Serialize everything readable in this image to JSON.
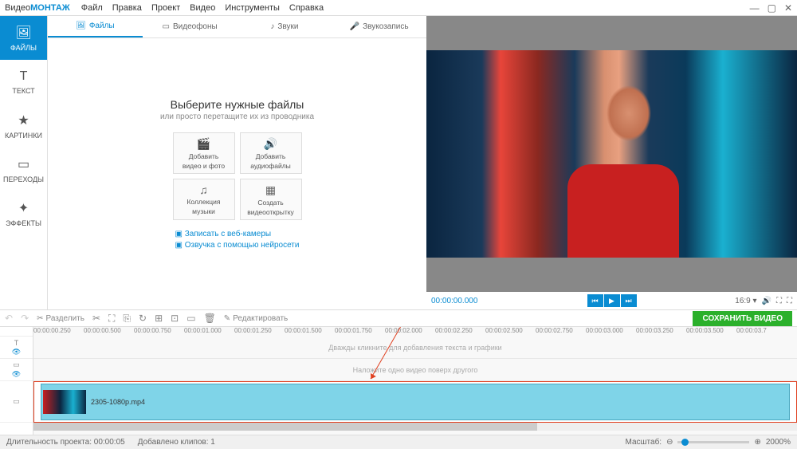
{
  "app": {
    "title_prefix": "Видео",
    "title_accent": "МОНТАЖ"
  },
  "menu": [
    "Файл",
    "Правка",
    "Проект",
    "Видео",
    "Инструменты",
    "Справка"
  ],
  "sidebar": [
    {
      "label": "ФАЙЛЫ",
      "icon": "🖼"
    },
    {
      "label": "ТЕКСТ",
      "icon": "T"
    },
    {
      "label": "КАРТИНКИ",
      "icon": "★"
    },
    {
      "label": "ПЕРЕХОДЫ",
      "icon": "▭"
    },
    {
      "label": "ЭФФЕКТЫ",
      "icon": "✦"
    }
  ],
  "center_tabs": [
    {
      "label": "Файлы",
      "icon": "🖼"
    },
    {
      "label": "Видеофоны",
      "icon": "▭"
    },
    {
      "label": "Звуки",
      "icon": "♪"
    },
    {
      "label": "Звукозапись",
      "icon": "🎤"
    }
  ],
  "drop": {
    "heading": "Выберите нужные файлы",
    "subheading": "или просто перетащите их из проводника",
    "buttons": [
      {
        "icon": "🎬",
        "line1": "Добавить",
        "line2": "видео и фото"
      },
      {
        "icon": "🔊",
        "line1": "Добавить",
        "line2": "аудиофайлы"
      },
      {
        "icon": "♫",
        "line1": "Коллекция",
        "line2": "музыки"
      },
      {
        "icon": "▦",
        "line1": "Создать",
        "line2": "видеооткрытку"
      }
    ],
    "link1": "Записать с веб-камеры",
    "link2": "Озвучка с помощью нейросети"
  },
  "preview": {
    "time": "00:00:00.000",
    "aspect": "16:9 ▾"
  },
  "toolbar": {
    "split": "Разделить",
    "edit": "Редактировать",
    "save": "СОХРАНИТЬ ВИДЕО"
  },
  "ruler": [
    "00:00:00.250",
    "00:00:00.500",
    "00:00:00.750",
    "00:00:01.000",
    "00:00:01.250",
    "00:00:01.500",
    "00:00:01.750",
    "00:00:02.000",
    "00:00:02.250",
    "00:00:02.500",
    "00:00:02.750",
    "00:00:03.000",
    "00:00:03.250",
    "00:00:03.500",
    "00:00:03.7"
  ],
  "tracks": {
    "hint1": "Дважды кликните для добавления текста и графики",
    "hint2": "Наложите одно видео поверх другого",
    "clip_name": "2305-1080p.mp4"
  },
  "status": {
    "duration": "Длительность проекта:  00:00:05",
    "clips": "Добавлено клипов:  1",
    "zoom_label": "Масштаб:",
    "zoom_value": "2000%"
  }
}
